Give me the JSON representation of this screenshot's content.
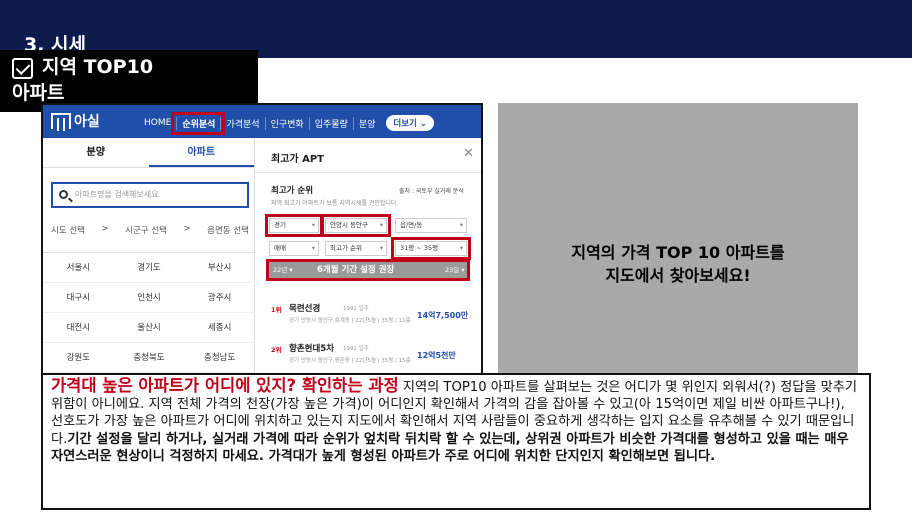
{
  "slide": {
    "section_title": "3. 시세",
    "heading_line1": "지역 TOP10",
    "heading_line2": "아파트"
  },
  "app": {
    "logo": "아실",
    "nav": [
      "HOME",
      "순위분석",
      "가격분석",
      "인구변화",
      "입주물량",
      "분양"
    ],
    "more_label": "더보기",
    "colors": {
      "brand": "#1f4fa8",
      "highlight": "#c0001a"
    }
  },
  "left_panel": {
    "tabs": [
      "분양",
      "아파트"
    ],
    "search_placeholder": "아파트명을 검색해보세요.",
    "region_select": [
      "시도 선택",
      ">",
      "시군구 선택",
      ">",
      "읍면동 선택"
    ],
    "regions": [
      "서울시",
      "경기도",
      "부산시",
      "대구시",
      "인천시",
      "광주시",
      "대전시",
      "울산시",
      "세종시",
      "강원도",
      "충청북도",
      "충청남도"
    ]
  },
  "right_panel": {
    "title": "최고가 APT",
    "subtitle": "최고가 순위",
    "source": "출처 : 국토부 실거래 분석",
    "description": "지역 최고가 아파트가 보통 지역시세를 견인합니다.",
    "selects": [
      "경기",
      "안양시 동안구",
      "읍/면/동",
      "매매",
      "최고가 순위",
      "31평 ~ 35평"
    ],
    "range_left": "22년 ▾",
    "range_middle": "6개월 기간 설정 권장",
    "range_right": "23일 ▾",
    "ranks": [
      {
        "rank": "1위",
        "name": "목련선경",
        "year": "1992 입주",
        "price": "14억7,500만",
        "info": "경기 안양시 동안구 호계동 | 22년5월 | 35평 | 11층"
      },
      {
        "rank": "2위",
        "name": "향촌현대5차",
        "year": "1992 입주",
        "price": "12억5천만",
        "info": "경기 안양시 동안구 평촌동 | 22년5월 | 35평 | 15층"
      }
    ]
  },
  "gray_box": {
    "line1": "지역의 가격 TOP 10 아파트를",
    "line2": "지도에서 찾아보세요!"
  },
  "note": {
    "red": "가격대 높은 아파트가 어디에 있지? 확인하는 과정",
    "text": " 지역의 TOP10 아파트를 살펴보는 것은 어디가 몇 위인지 외워서(?) 정답을 맞추기 위함이 아니에요. 지역 전체 가격의 천장(가장 높은 가격)이 어디인지 확인해서 가격의 감을 잡아볼 수 있고(아 15억이면 제일 비싼 아파트구나!), 선호도가 가장 높은 아파트가 어디에 위치하고 있는지 지도에서 확인해서 지역 사람들이 중요하게 생각하는 입지 요소를 유추해볼 수 있기 때문입니다.",
    "bold": "기간 설정을 달리 하거나, 실거래 가격에 따라 순위가 엎치락 뒤치락 할 수 있는데, 상위권 아파트가 비슷한 가격대를 형성하고 있을 때는 매우 자연스러운 현상이니 걱정하지 마세요. 가격대가 높게 형성된 아파트가 주로 어디에 위치한 단지인지 확인해보면 됩니다."
  }
}
